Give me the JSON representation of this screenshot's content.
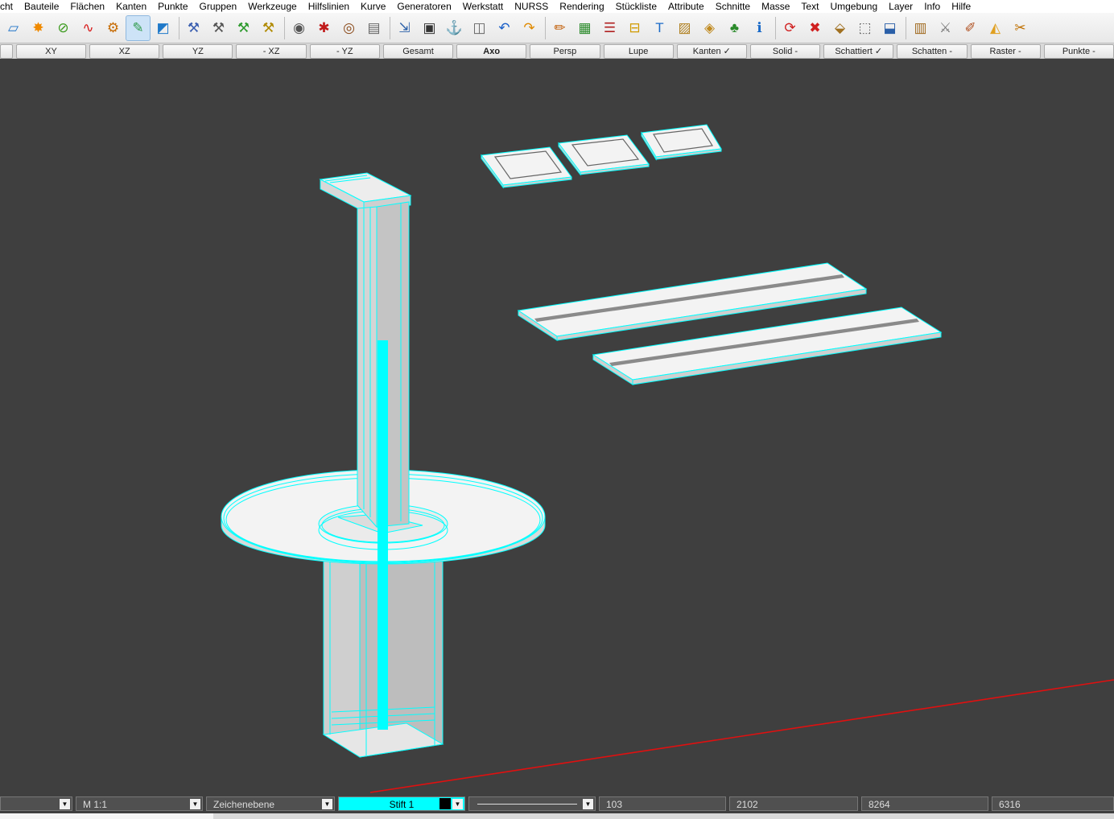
{
  "menu": [
    "cht",
    "Bauteile",
    "Flächen",
    "Kanten",
    "Punkte",
    "Gruppen",
    "Werkzeuge",
    "Hilfslinien",
    "Kurve",
    "Generatoren",
    "Werkstatt",
    "NURSS",
    "Rendering",
    "Stückliste",
    "Attribute",
    "Schnitte",
    "Masse",
    "Text",
    "Umgebung",
    "Layer",
    "Info",
    "Hilfe"
  ],
  "toolbar_icons": [
    {
      "name": "line-tool-icon",
      "glyph": "▱",
      "color": "#1e73c8"
    },
    {
      "name": "star-tool-icon",
      "glyph": "✸",
      "color": "#f08a00"
    },
    {
      "name": "compass-tool-icon",
      "glyph": "⊘",
      "color": "#3a9a1c"
    },
    {
      "name": "curve-tool-icon",
      "glyph": "∿",
      "color": "#d81a1a"
    },
    {
      "name": "gear-tool-icon",
      "glyph": "⚙",
      "color": "#c76b00"
    },
    {
      "name": "drill-tool-icon",
      "glyph": "✎",
      "color": "#2f9a4a"
    },
    {
      "name": "plane-tool-icon",
      "glyph": "◩",
      "color": "#1f79c9"
    },
    {
      "name": "hammer-blue-icon",
      "glyph": "⚒",
      "color": "#3b5fb0"
    },
    {
      "name": "hammer-grey-icon",
      "glyph": "⚒",
      "color": "#555555"
    },
    {
      "name": "hammer-green-icon",
      "glyph": "⚒",
      "color": "#2d9a2d"
    },
    {
      "name": "hammer-yellow-icon",
      "glyph": "⚒",
      "color": "#b08a00"
    },
    {
      "name": "camera-icon",
      "glyph": "◉",
      "color": "#555555"
    },
    {
      "name": "spider-icon",
      "glyph": "✱",
      "color": "#c01a1a"
    },
    {
      "name": "eye-icon",
      "glyph": "◎",
      "color": "#8a4a1a"
    },
    {
      "name": "printer-icon",
      "glyph": "▤",
      "color": "#666666"
    },
    {
      "name": "import-icon",
      "glyph": "⇲",
      "color": "#2a5fa8"
    },
    {
      "name": "save-icon",
      "glyph": "▣",
      "color": "#333333"
    },
    {
      "name": "anchor-icon",
      "glyph": "⚓",
      "color": "#1a7ad0"
    },
    {
      "name": "bucket-icon",
      "glyph": "◫",
      "color": "#666666"
    },
    {
      "name": "undo-icon",
      "glyph": "↶",
      "color": "#1a5fc8"
    },
    {
      "name": "redo-icon",
      "glyph": "↷",
      "color": "#e08a00"
    },
    {
      "name": "pencil-icon",
      "glyph": "✏",
      "color": "#c05a00"
    },
    {
      "name": "spreadsheet-icon",
      "glyph": "▦",
      "color": "#2a8a2a"
    },
    {
      "name": "list-icon",
      "glyph": "☰",
      "color": "#b02020"
    },
    {
      "name": "dimension-icon",
      "glyph": "⊟",
      "color": "#d09a00"
    },
    {
      "name": "text-icon",
      "glyph": "T",
      "color": "#1a6ac8"
    },
    {
      "name": "hatch-icon",
      "glyph": "▨",
      "color": "#b08020"
    },
    {
      "name": "layers-icon",
      "glyph": "◈",
      "color": "#c08a20"
    },
    {
      "name": "tree-icon",
      "glyph": "♣",
      "color": "#2a8a2a"
    },
    {
      "name": "info-icon",
      "glyph": "ℹ",
      "color": "#1a6ac8"
    },
    {
      "name": "refresh-icon",
      "glyph": "⟳",
      "color": "#d02020"
    },
    {
      "name": "delete-icon",
      "glyph": "✖",
      "color": "#d02020"
    },
    {
      "name": "cube-move-icon",
      "glyph": "⬙",
      "color": "#a07020"
    },
    {
      "name": "cube-copy-icon",
      "glyph": "⬚",
      "color": "#666666"
    },
    {
      "name": "cube-stack-icon",
      "glyph": "⬓",
      "color": "#2a5fa8"
    },
    {
      "name": "chest-icon",
      "glyph": "▥",
      "color": "#a06a20"
    },
    {
      "name": "saw-icon",
      "glyph": "⚔",
      "color": "#777777"
    },
    {
      "name": "brush-icon",
      "glyph": "✐",
      "color": "#b05020"
    },
    {
      "name": "cheese-icon",
      "glyph": "◭",
      "color": "#e0a020"
    },
    {
      "name": "scissors-icon",
      "glyph": "✂",
      "color": "#c07000"
    }
  ],
  "view_buttons": [
    {
      "label": "",
      "bold": false
    },
    {
      "label": "XY",
      "bold": false
    },
    {
      "label": "XZ",
      "bold": false
    },
    {
      "label": "YZ",
      "bold": false
    },
    {
      "label": "- XZ",
      "bold": false
    },
    {
      "label": "- YZ",
      "bold": false
    },
    {
      "label": "Gesamt",
      "bold": false
    },
    {
      "label": "Axo",
      "bold": true
    },
    {
      "label": "Persp",
      "bold": false
    },
    {
      "label": "Lupe",
      "bold": false
    },
    {
      "label": "Kanten ✓",
      "bold": false
    },
    {
      "label": "Solid -",
      "bold": false
    },
    {
      "label": "Schattiert ✓",
      "bold": false
    },
    {
      "label": "Schatten -",
      "bold": false
    },
    {
      "label": "Raster -",
      "bold": false
    },
    {
      "label": "Punkte -",
      "bold": false
    }
  ],
  "status": {
    "scale": "M 1:1",
    "plane": "Zeichenebene",
    "pen": "Stift 1",
    "v1": "103",
    "v2": "2102",
    "v3": "8264",
    "v4": "6316"
  },
  "colors": {
    "wire": "#00ffff",
    "axis": "#e01010",
    "face": "#f2f2f2",
    "face_dark": "#c9c9c9",
    "bg": "#3f3f3f"
  }
}
